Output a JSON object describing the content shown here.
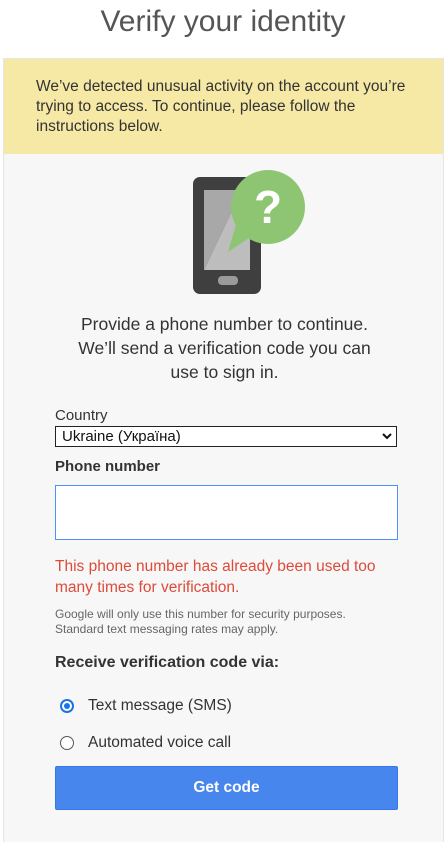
{
  "page": {
    "title": "Verify your identity"
  },
  "warning": {
    "text": "We’ve detected unusual activity on the account you’re trying to access. To continue, please follow the instructions below."
  },
  "intro": {
    "line1": "Provide a phone number to continue.",
    "line2": "We’ll send a verification code you can",
    "line3": "use to sign in."
  },
  "country": {
    "label": "Country",
    "selected": "Ukraine (Україна)"
  },
  "phone": {
    "label": "Phone number",
    "value": "",
    "error": "This phone number has already been used too many times for verification.",
    "note_line1": "Google will only use this number for security purposes.",
    "note_line2": "Standard text messaging rates may apply."
  },
  "receive": {
    "title": "Receive verification code via:",
    "options": [
      {
        "label": "Text message (SMS)",
        "checked": true
      },
      {
        "label": "Automated voice call",
        "checked": false
      }
    ]
  },
  "button": {
    "label": "Get code"
  },
  "colors": {
    "warning_bg": "#f6e8a5",
    "error": "#dd4b39",
    "primary_button": "#4787ed",
    "radio_selected": "#1a73e8",
    "bubble": "#8dc572"
  },
  "icons": {
    "illustration": "phone-question-icon"
  }
}
